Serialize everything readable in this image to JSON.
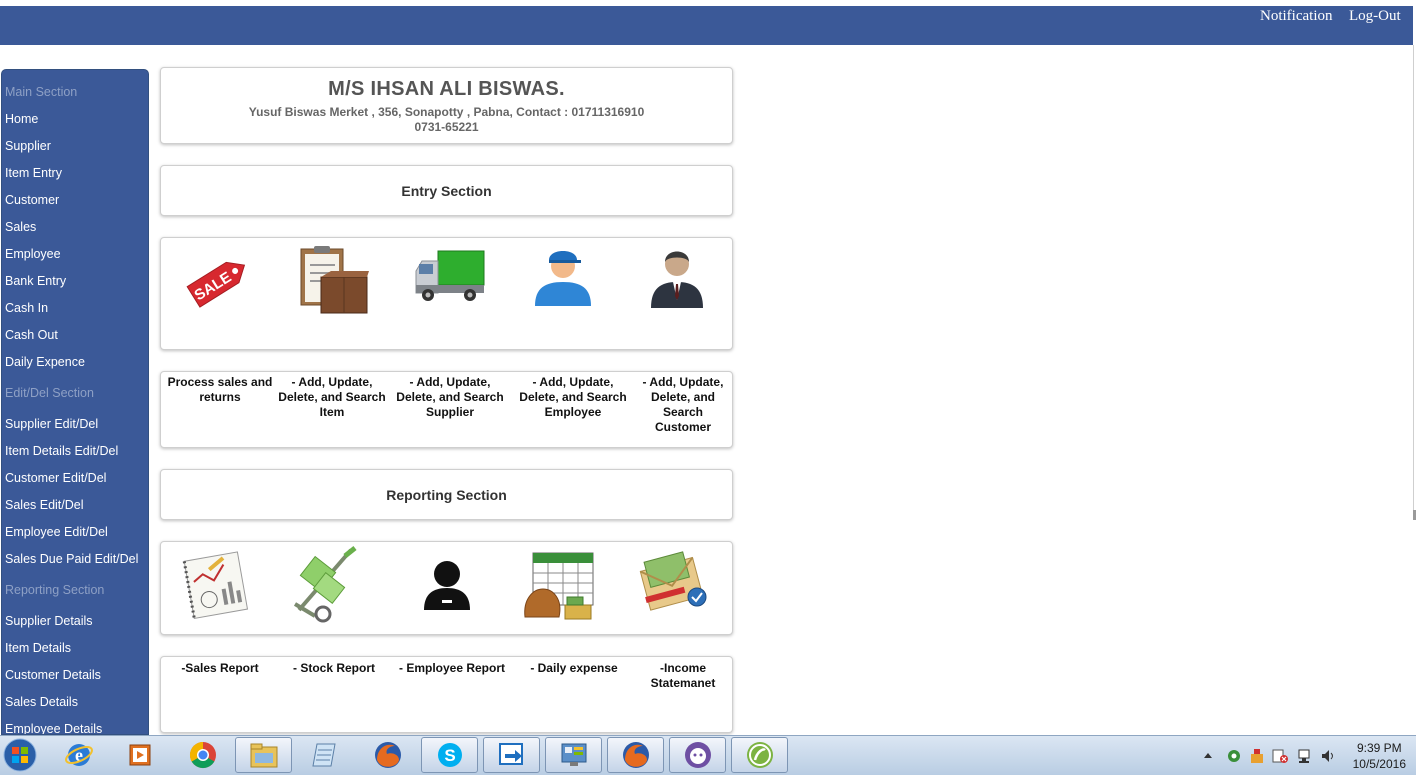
{
  "navbar": {
    "notification": "Notification",
    "logout": "Log-Out"
  },
  "sidebar": {
    "main_section": "Main Section",
    "main_items": [
      "Home",
      "Supplier",
      "Item Entry",
      "Customer",
      "Sales",
      "Employee",
      "Bank Entry",
      "Cash In",
      "Cash Out",
      "Daily Expence"
    ],
    "editdel_section": "Edit/Del Section",
    "editdel_items": [
      "Supplier Edit/Del",
      "Item Details Edit/Del",
      "Customer Edit/Del",
      "Sales Edit/Del",
      "Employee Edit/Del",
      "Sales Due Paid Edit/Del"
    ],
    "reporting_section": "Reporting Section",
    "reporting_items": [
      "Supplier Details",
      "Item Details",
      "Customer Details",
      "Sales Details",
      "Employee Details"
    ]
  },
  "header": {
    "company": "M/S IHSAN ALI BISWAS.",
    "address_line1": "Yusuf Biswas Merket , 356, Sonapotty , Pabna, Contact : 01711316910",
    "address_line2": "0731-65221"
  },
  "entry_section": {
    "title": "Entry Section",
    "icons": [
      "sale-tag-icon",
      "clipboard-box-icon",
      "delivery-truck-icon",
      "worker-icon",
      "businessman-icon"
    ],
    "descriptions": [
      "Process sales and returns",
      "- Add, Update, Delete, and Search Item",
      "- Add, Update, Delete, and Search Supplier",
      "- Add, Update, Delete, and Search Employee",
      "- Add, Update, Delete, and Search Customer"
    ]
  },
  "reporting_section": {
    "title": "Reporting Section",
    "icons": [
      "sales-report-icon",
      "hand-truck-icon",
      "employee-silhouette-icon",
      "calendar-money-icon",
      "envelope-money-icon"
    ],
    "descriptions": [
      "-Sales Report",
      "- Stock Report",
      "- Employee Report",
      "- Daily expense",
      "-Income Statemanet"
    ]
  },
  "taskbar": {
    "apps": [
      "ie-icon",
      "media-player-icon",
      "chrome-icon",
      "file-explorer-icon",
      "notepad-icon",
      "firefox-icon",
      "skype-icon",
      "teamviewer-icon",
      "control-panel-icon",
      "firefox-icon",
      "github-icon",
      "dreamweaver-icon"
    ],
    "time": "9:39 PM",
    "date": "10/5/2016"
  },
  "colors": {
    "navbar": "#3b5998",
    "sidebar": "#3b5998",
    "section_label": "#8ea0c5"
  }
}
